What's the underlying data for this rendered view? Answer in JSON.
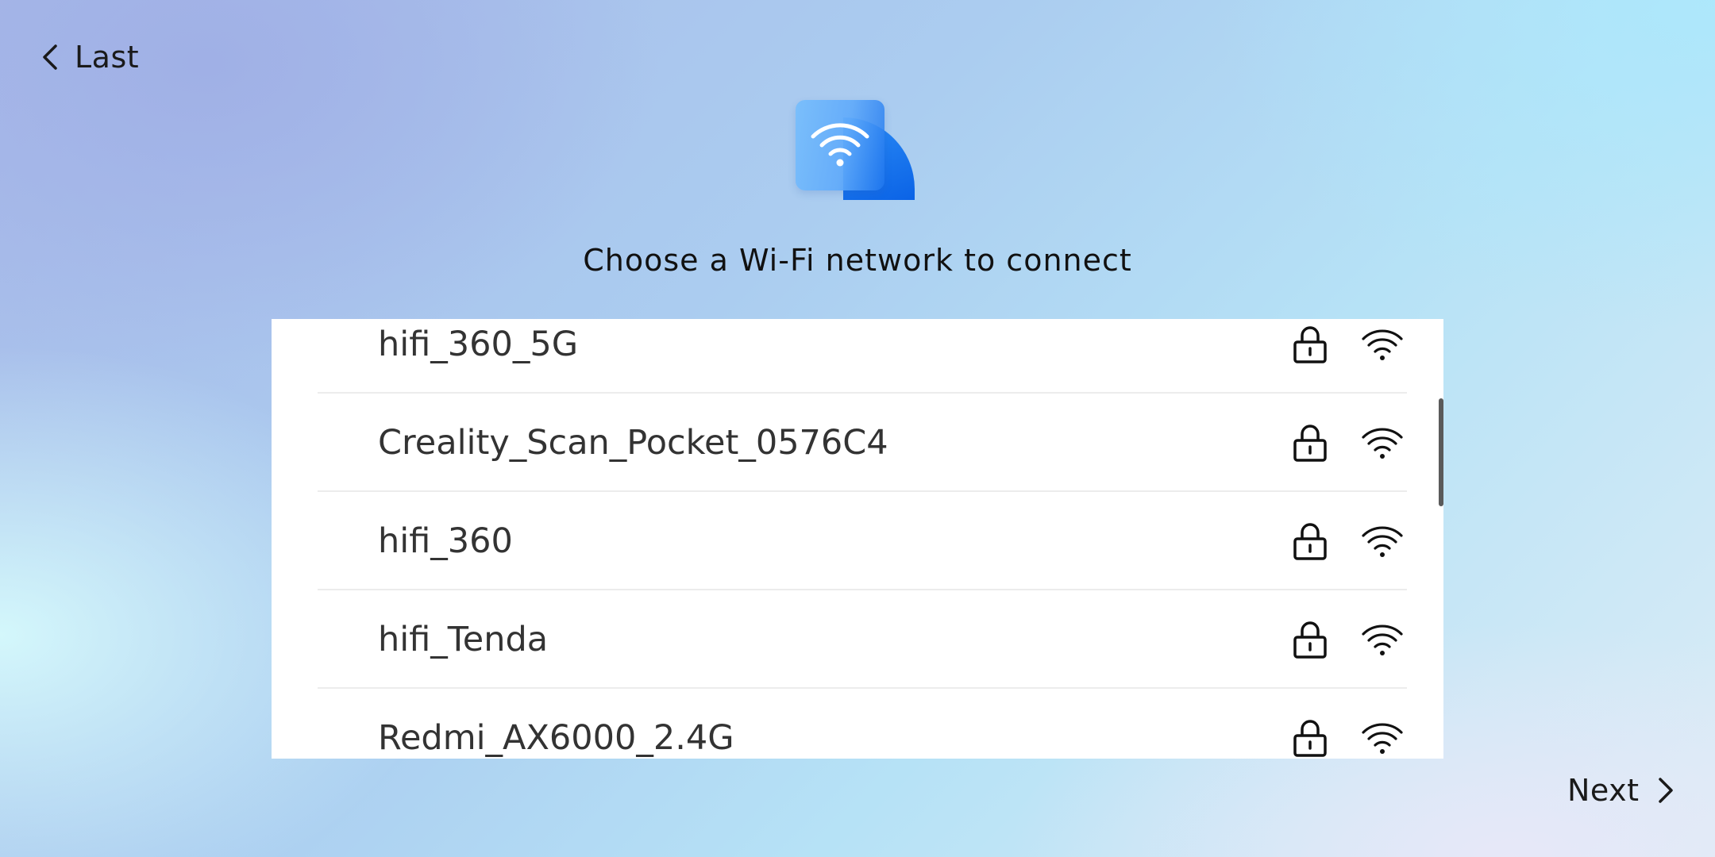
{
  "nav": {
    "back_label": "Last",
    "next_label": "Next"
  },
  "header": {
    "icon": "wifi-setup-icon",
    "title": "Choose a Wi-Fi network to connect"
  },
  "networks": [
    {
      "ssid": "hifi_360_5G",
      "secured": true,
      "signal": "full"
    },
    {
      "ssid": "Creality_Scan_Pocket_0576C4",
      "secured": true,
      "signal": "full"
    },
    {
      "ssid": "hifi_360",
      "secured": true,
      "signal": "full"
    },
    {
      "ssid": "hifi_Tenda",
      "secured": true,
      "signal": "full"
    },
    {
      "ssid": "Redmi_AX6000_2.4G",
      "secured": true,
      "signal": "full"
    }
  ],
  "colors": {
    "accent": "#0b63e6",
    "icon_light": "#78befc",
    "text": "#1a1a1a",
    "panel": "#ffffff",
    "divider": "#ececec"
  }
}
